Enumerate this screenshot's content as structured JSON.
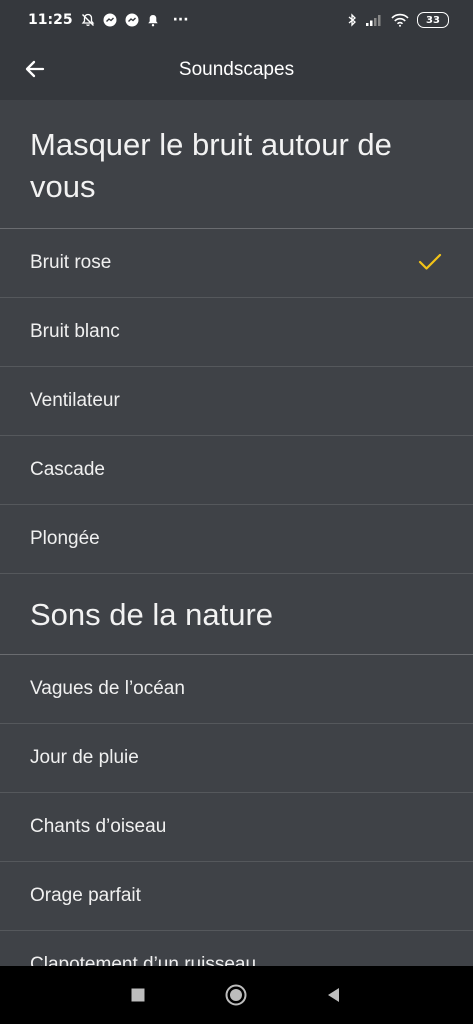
{
  "status_bar": {
    "time": "11:25",
    "more": "···",
    "battery": "33",
    "left_icons": [
      "bell-off-icon",
      "messenger-icon",
      "messenger-icon",
      "bell-icon"
    ],
    "right_icons": [
      "bluetooth-icon",
      "signal-icon",
      "wifi-icon",
      "battery-icon"
    ]
  },
  "app_bar": {
    "title": "Soundscapes",
    "back_icon": "arrow-left-icon"
  },
  "sections": [
    {
      "title": "Masquer le bruit autour de vous",
      "items": [
        {
          "label": "Bruit rose",
          "selected": true
        },
        {
          "label": "Bruit blanc",
          "selected": false
        },
        {
          "label": "Ventilateur",
          "selected": false
        },
        {
          "label": "Cascade",
          "selected": false
        },
        {
          "label": "Plongée",
          "selected": false
        }
      ]
    },
    {
      "title": "Sons de la nature",
      "items": [
        {
          "label": "Vagues de l’océan",
          "selected": false
        },
        {
          "label": "Jour de pluie",
          "selected": false
        },
        {
          "label": "Chants d’oiseau",
          "selected": false
        },
        {
          "label": "Orage parfait",
          "selected": false
        },
        {
          "label": "Clapotement d’un ruisseau",
          "selected": false
        }
      ]
    }
  ],
  "colors": {
    "background": "#3f4247",
    "bar": "#35383d",
    "check": "#f2c318"
  },
  "nav_bar": {
    "icons": [
      "square-icon",
      "circle-icon",
      "triangle-back-icon"
    ]
  }
}
